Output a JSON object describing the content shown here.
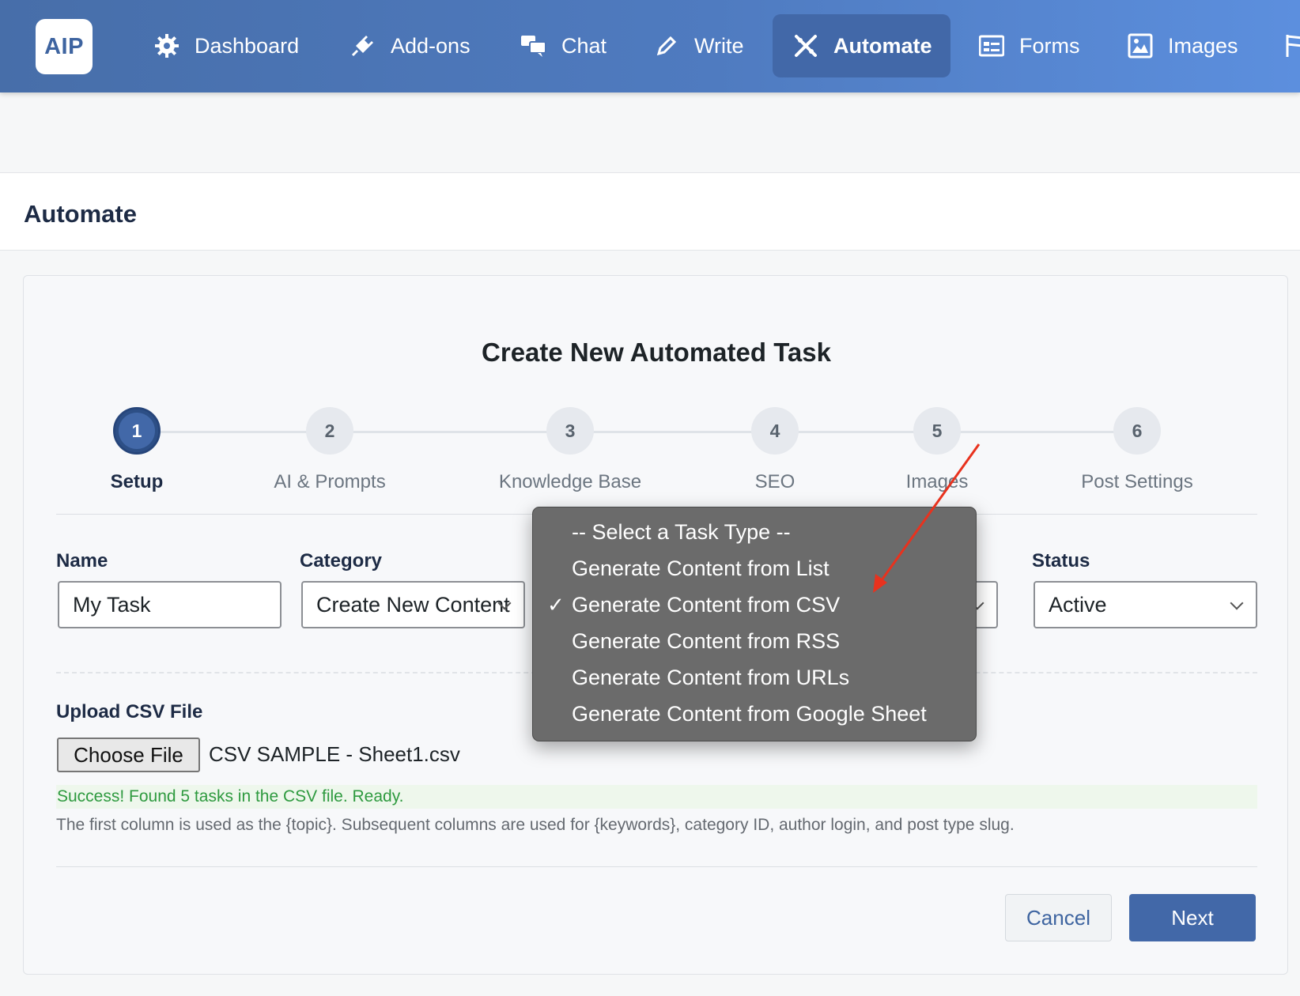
{
  "nav": {
    "logo": "AIP",
    "items": [
      {
        "label": "Dashboard",
        "icon": "gear-icon"
      },
      {
        "label": "Add-ons",
        "icon": "plug-icon"
      },
      {
        "label": "Chat",
        "icon": "chat-icon"
      },
      {
        "label": "Write",
        "icon": "pencil-icon"
      },
      {
        "label": "Automate",
        "icon": "automate-icon",
        "active": true
      },
      {
        "label": "Forms",
        "icon": "form-icon"
      },
      {
        "label": "Images",
        "icon": "image-icon"
      }
    ]
  },
  "page": {
    "title": "Automate"
  },
  "wizard": {
    "title": "Create New Automated Task",
    "steps": [
      {
        "number": "1",
        "label": "Setup"
      },
      {
        "number": "2",
        "label": "AI & Prompts"
      },
      {
        "number": "3",
        "label": "Knowledge Base"
      },
      {
        "number": "4",
        "label": "SEO"
      },
      {
        "number": "5",
        "label": "Images"
      },
      {
        "number": "6",
        "label": "Post Settings"
      }
    ],
    "current_step": 1
  },
  "form": {
    "name_label": "Name",
    "name_value": "My Task",
    "category_label": "Category",
    "category_value": "Create New Content",
    "status_label": "Status",
    "status_value": "Active",
    "upload_label": "Upload CSV File",
    "choose_file_label": "Choose File",
    "file_name": "CSV SAMPLE - Sheet1.csv",
    "success_message": "Success! Found 5 tasks in the CSV file. Ready.",
    "hint": "The first column is used as the {topic}. Subsequent columns are used for {keywords}, category ID, author login, and post type slug."
  },
  "task_type_dropdown": {
    "options": [
      "-- Select a Task Type --",
      "Generate Content from List",
      "Generate Content from CSV",
      "Generate Content from RSS",
      "Generate Content from URLs",
      "Generate Content from Google Sheet"
    ],
    "selected": "Generate Content from CSV",
    "check_mark": "✓"
  },
  "actions": {
    "cancel_label": "Cancel",
    "next_label": "Next"
  },
  "colors": {
    "nav_start": "#476ea9",
    "nav_end": "#5c8fde",
    "primary": "#4268a8",
    "success_text": "#2e9a3f",
    "annotation_arrow": "#e8321e"
  }
}
